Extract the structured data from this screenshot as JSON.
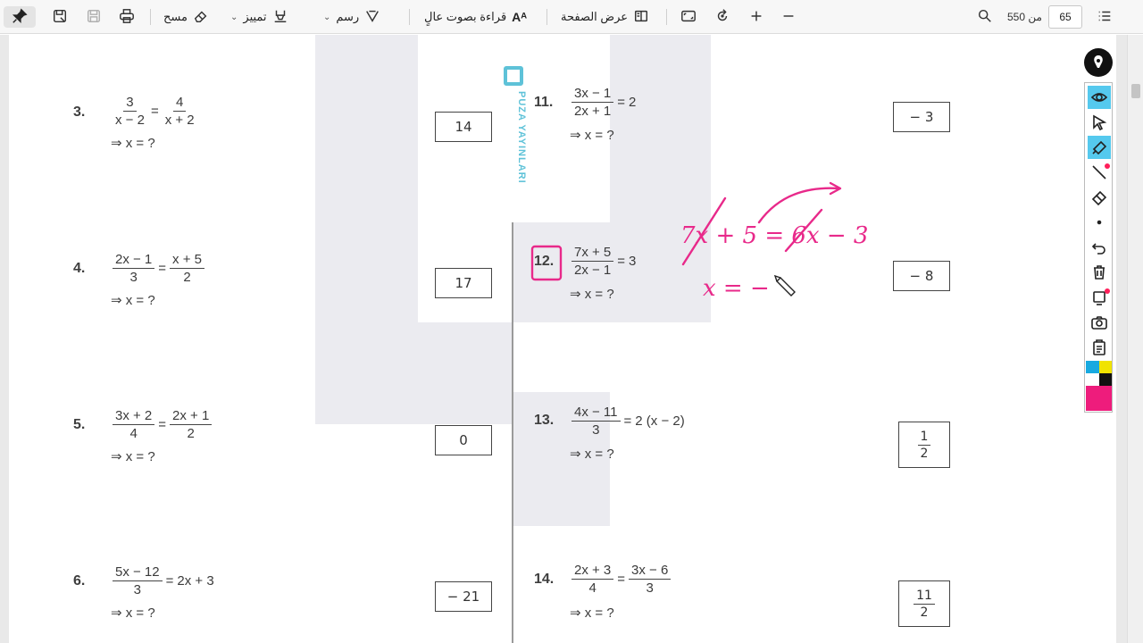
{
  "toolbar": {
    "pin_icon": "pin-icon",
    "save_icon": "save-icon",
    "erase_label": "مسح",
    "highlight_label": "تمييز",
    "draw_label": "رسم",
    "read_aloud_label": "قراءة بصوت عالٍ",
    "page_view_label": "عرض الصفحة",
    "current_page": "65",
    "page_total": "من 550",
    "colors": {
      "background": "#f7f7f7",
      "text": "#222222"
    }
  },
  "worksheet": {
    "publisher_watermark": "PUZA YAYINLARI",
    "left_column": [
      {
        "number": "3.",
        "lhs_num": "3",
        "lhs_den": "x − 2",
        "op": "=",
        "rhs_num": "4",
        "rhs_den": "x + 2",
        "rhs_text": "",
        "question": "⇒ x = ?",
        "answer": "14"
      },
      {
        "number": "4.",
        "lhs_num": "2x − 1",
        "lhs_den": "3",
        "op": "=",
        "rhs_num": "x + 5",
        "rhs_den": "2",
        "rhs_text": "",
        "question": "⇒ x = ?",
        "answer": "17"
      },
      {
        "number": "5.",
        "lhs_num": "3x + 2",
        "lhs_den": "4",
        "op": "=",
        "rhs_num": "2x + 1",
        "rhs_den": "2",
        "rhs_text": "",
        "question": "⇒ x = ?",
        "answer": "0"
      },
      {
        "number": "6.",
        "lhs_num": "5x − 12",
        "lhs_den": "3",
        "op": "=",
        "rhs_num": "",
        "rhs_den": "",
        "rhs_text": "2x + 3",
        "question": "⇒ x = ?",
        "answer": "− 21"
      }
    ],
    "right_column": [
      {
        "number": "11.",
        "lhs_num": "3x − 1",
        "lhs_den": "2x + 1",
        "op": "=",
        "rhs_text": "2",
        "question": "⇒ x = ?",
        "answer": "− 3"
      },
      {
        "number": "12.",
        "lhs_num": "7x + 5",
        "lhs_den": "2x − 1",
        "op": "=",
        "rhs_text": "3",
        "question": "⇒ x = ?",
        "answer": "− 8"
      },
      {
        "number": "13.",
        "lhs_num": "4x − 11",
        "lhs_den": "3",
        "op": "=",
        "rhs_text": "2 (x − 2)",
        "question": "⇒ x = ?",
        "answer_num": "1",
        "answer_den": "2"
      },
      {
        "number": "14.",
        "lhs_num": "2x + 3",
        "lhs_den": "4",
        "op": "=",
        "rhs_num": "3x − 6",
        "rhs_den": "3",
        "question": "⇒ x = ?",
        "answer_num": "11",
        "answer_den": "2"
      }
    ],
    "handwriting": {
      "color": "#e8298a",
      "line1": "7x + 5 = 6x − 3",
      "line2": "x = −"
    }
  },
  "palette": {
    "tools": [
      "logo-pen-icon",
      "eye-icon",
      "cursor-icon",
      "highlighter-icon",
      "pen-icon",
      "eraser-icon",
      "dot-icon",
      "undo-icon",
      "trash-icon",
      "stamp-icon",
      "camera-icon",
      "clipboard-icon"
    ],
    "colors": [
      "#17a9e0",
      "#f0e300",
      "#ffffff",
      "#111111",
      "#ee1c7c"
    ]
  }
}
